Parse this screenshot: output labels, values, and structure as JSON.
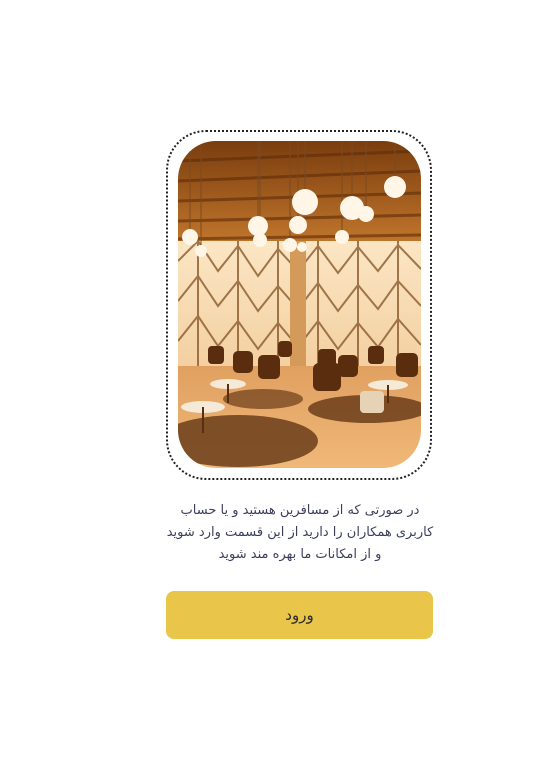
{
  "image": {
    "description_icon": "lounge-photo"
  },
  "message": {
    "line1": "در صورتی که از مسافرین هستید و یا حساب",
    "line2": "کاربری همکاران را دارید از این قسمت وارد شوید",
    "line3": "و از امکانات ما بهره مند شوید"
  },
  "login_button": {
    "label": "ورود"
  },
  "colors": {
    "button": "#e9c64a",
    "text": "#3b3f5c"
  }
}
